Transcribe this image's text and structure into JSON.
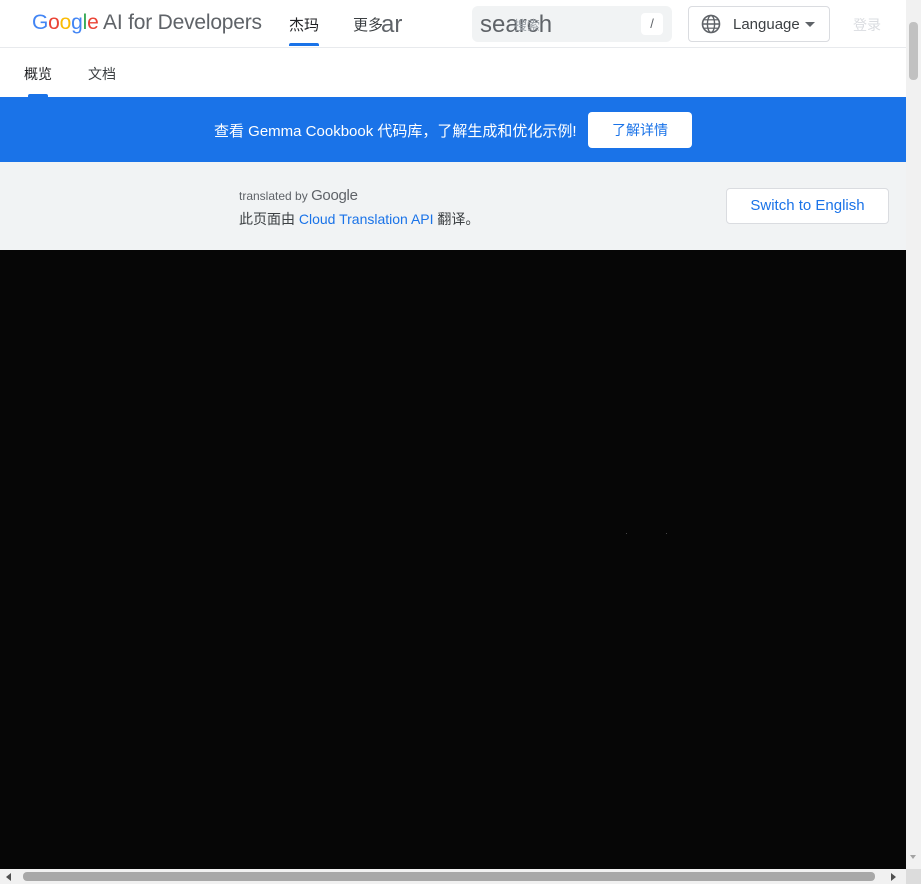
{
  "header": {
    "logo_letters": [
      "G",
      "o",
      "o",
      "g",
      "l",
      "e"
    ],
    "logo_rest": " AI for Developers",
    "tabs": [
      {
        "label": "杰玛",
        "active": true
      },
      {
        "label": "更多"
      }
    ],
    "more_overflow": "ar",
    "search": {
      "placeholder": "search",
      "placeholder_overlay": "搜索",
      "shortcut": "/"
    },
    "language": {
      "label": "Language",
      "icon": "globe-icon"
    },
    "signin_label": "登录"
  },
  "subnav": {
    "tabs": [
      {
        "label": "概览",
        "active": true
      },
      {
        "label": "文档"
      }
    ]
  },
  "banner": {
    "text": "查看 Gemma Cookbook 代码库，了解生成和优化示例!",
    "button_label": "了解详情",
    "color": "#1a73e8"
  },
  "translation": {
    "translated_by": "translated by",
    "google": "Google",
    "prefix": "此页面由",
    "link": "Cloud Translation API",
    "suffix": "翻译。",
    "switch_label": "Switch to English"
  }
}
